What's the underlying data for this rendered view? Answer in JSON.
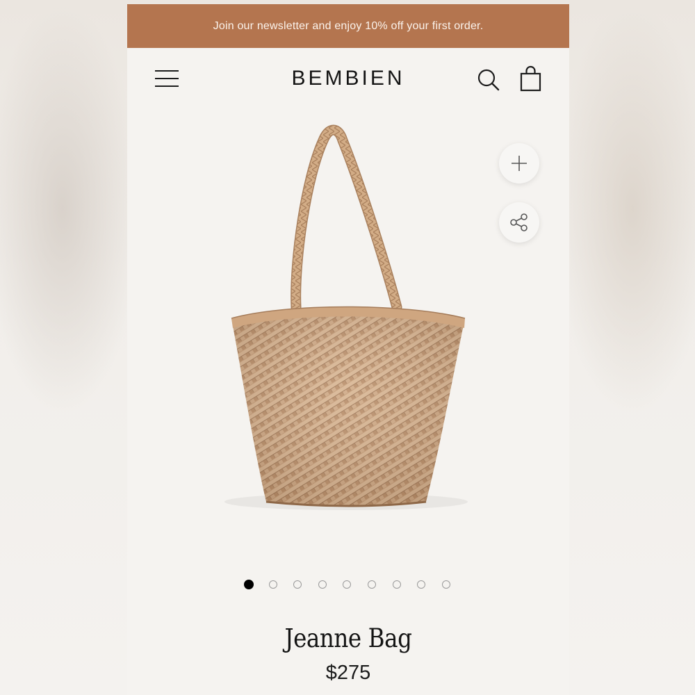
{
  "banner": {
    "text": "Join our newsletter and enjoy 10% off your first order."
  },
  "header": {
    "logo": "BEMBIEN"
  },
  "icons": {
    "menu": "hamburger-menu-icon",
    "search": "search-icon",
    "bag": "shopping-bag-icon",
    "add": "plus-icon",
    "share": "share-icon"
  },
  "gallery": {
    "total_images": 9,
    "active_index": 0
  },
  "product": {
    "name": "Jeanne Bag",
    "price": "$275"
  },
  "colors": {
    "banner": "#b4754f",
    "bag": "#c49b76",
    "background": "#f5f3f0"
  }
}
